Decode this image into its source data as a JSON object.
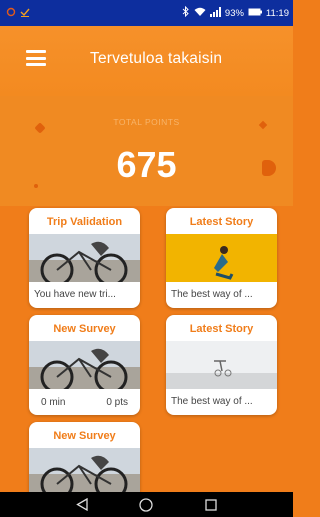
{
  "status_bar": {
    "battery_percent": "93%",
    "time": "11:19",
    "icons": [
      "notification-icon",
      "download-done-icon",
      "bluetooth-icon",
      "wifi-icon",
      "signal-icon",
      "battery-icon"
    ]
  },
  "header": {
    "title": "Tervetuloa takaisin",
    "menu_icon": "hamburger-menu-icon"
  },
  "summary": {
    "label": "TOTAL POINTS",
    "value": "675"
  },
  "cards": [
    {
      "title": "Trip Validation",
      "text": "You have new tri...",
      "image": "cyclist-photo"
    },
    {
      "title": "Latest Story",
      "text": "The best way of ...",
      "image": "cyclist-yellow-photo"
    },
    {
      "title": "New Survey",
      "duration": "0 min",
      "points": "0 pts",
      "image": "cyclist-photo"
    },
    {
      "title": "Latest Story",
      "text": "The best way of ...",
      "image": "cyclist-sky-photo"
    },
    {
      "title": "New Survey",
      "image": "cyclist-photo"
    }
  ],
  "nav": {
    "icons": [
      "back-icon",
      "home-icon",
      "recents-icon"
    ]
  },
  "colors": {
    "accent": "#f07d1a",
    "status_bar": "#0d2e9e",
    "nav_bar": "#000000"
  }
}
